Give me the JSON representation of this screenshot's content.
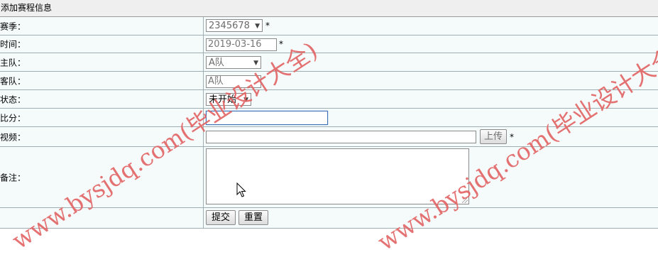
{
  "form": {
    "title": "添加赛程信息",
    "rows": {
      "season": {
        "label": "赛季：",
        "value": "2345678",
        "required": "*"
      },
      "time": {
        "label": "时间：",
        "value": "2019-03-16",
        "required": "*"
      },
      "home": {
        "label": "主队：",
        "value": "A队"
      },
      "away": {
        "label": "客队：",
        "value": "A队"
      },
      "status": {
        "label": "状态：",
        "value": "未开始"
      },
      "score": {
        "label": "比分：",
        "value": ""
      },
      "video": {
        "label": "视频：",
        "value": "",
        "upload_label": "上传",
        "required": "*"
      },
      "notes": {
        "label": "备注：",
        "value": ""
      }
    },
    "submit_label": "提交",
    "reset_label": "重置"
  },
  "watermark": {
    "text_a": "www.bysjdq.com(毕业设计大全)",
    "text_b": "www.bysjdq.com(毕业设计大全)",
    "color": "#e36363"
  },
  "colors": {
    "row_bg": "#f5fbfb",
    "border": "#9eaeb2",
    "title_bg": "#efefef"
  }
}
